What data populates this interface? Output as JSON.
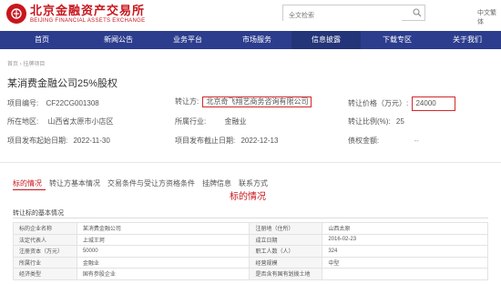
{
  "header": {
    "logo_cn": "北京金融资产交易所",
    "logo_en": "BEIJING FINANCIAL ASSETS EXCHANGE",
    "search_placeholder": "全文检索",
    "lang": "中文繁体"
  },
  "nav": [
    {
      "label": "首页"
    },
    {
      "label": "新闻公告"
    },
    {
      "label": "业务平台"
    },
    {
      "label": "市场服务"
    },
    {
      "label": "信息披露"
    },
    {
      "label": "下载专区"
    },
    {
      "label": "关于我们"
    }
  ],
  "breadcrumb": "首页 › 挂牌项目",
  "project": {
    "title": "某消费金融公司25%股权",
    "code_label": "项目编号:",
    "code": "CF22CG001308",
    "transferor_label": "转让方:",
    "transferor": "北京奇飞翔艺商务咨询有限公司",
    "price_label": "转让价格（万元）:",
    "price": "24000",
    "location_label": "所在地区:",
    "location": "山西省太原市小店区",
    "industry_label": "所属行业:",
    "industry": "金融业",
    "ratio_label": "转让比例(%):",
    "ratio": "25",
    "start_label": "项目发布起始日期:",
    "start": "2022-11-30",
    "end_label": "项目发布截止日期:",
    "end": "2022-12-13",
    "debt_label": "债权金额:",
    "debt": "--"
  },
  "tabs": [
    {
      "label": "标的情况"
    },
    {
      "label": "转让方基本情况"
    },
    {
      "label": "交易条件与受让方资格条件"
    },
    {
      "label": "挂牌信息"
    },
    {
      "label": "联系方式"
    }
  ],
  "section_title": "标的情况",
  "subsection": "转让标的基本情况",
  "table": [
    [
      "标的企业名称",
      "某消费金融公司",
      "注册地（住所）",
      "山西太原"
    ],
    [
      "法定代表人",
      "上城王珂",
      "成立日期",
      "2016-02-23"
    ],
    [
      "注册资本（万元）",
      "50000",
      "职工人数（人）",
      "324"
    ],
    [
      "所属行业",
      "金融业",
      "经营规模",
      "中型"
    ],
    [
      "经济类型",
      "国有参股企业",
      "是否含有国有划拨土地",
      ""
    ]
  ],
  "colors": {
    "nav_bg": "#2c3d8e",
    "brand_red": "#c8161d",
    "highlight_box": "#d4282c"
  }
}
